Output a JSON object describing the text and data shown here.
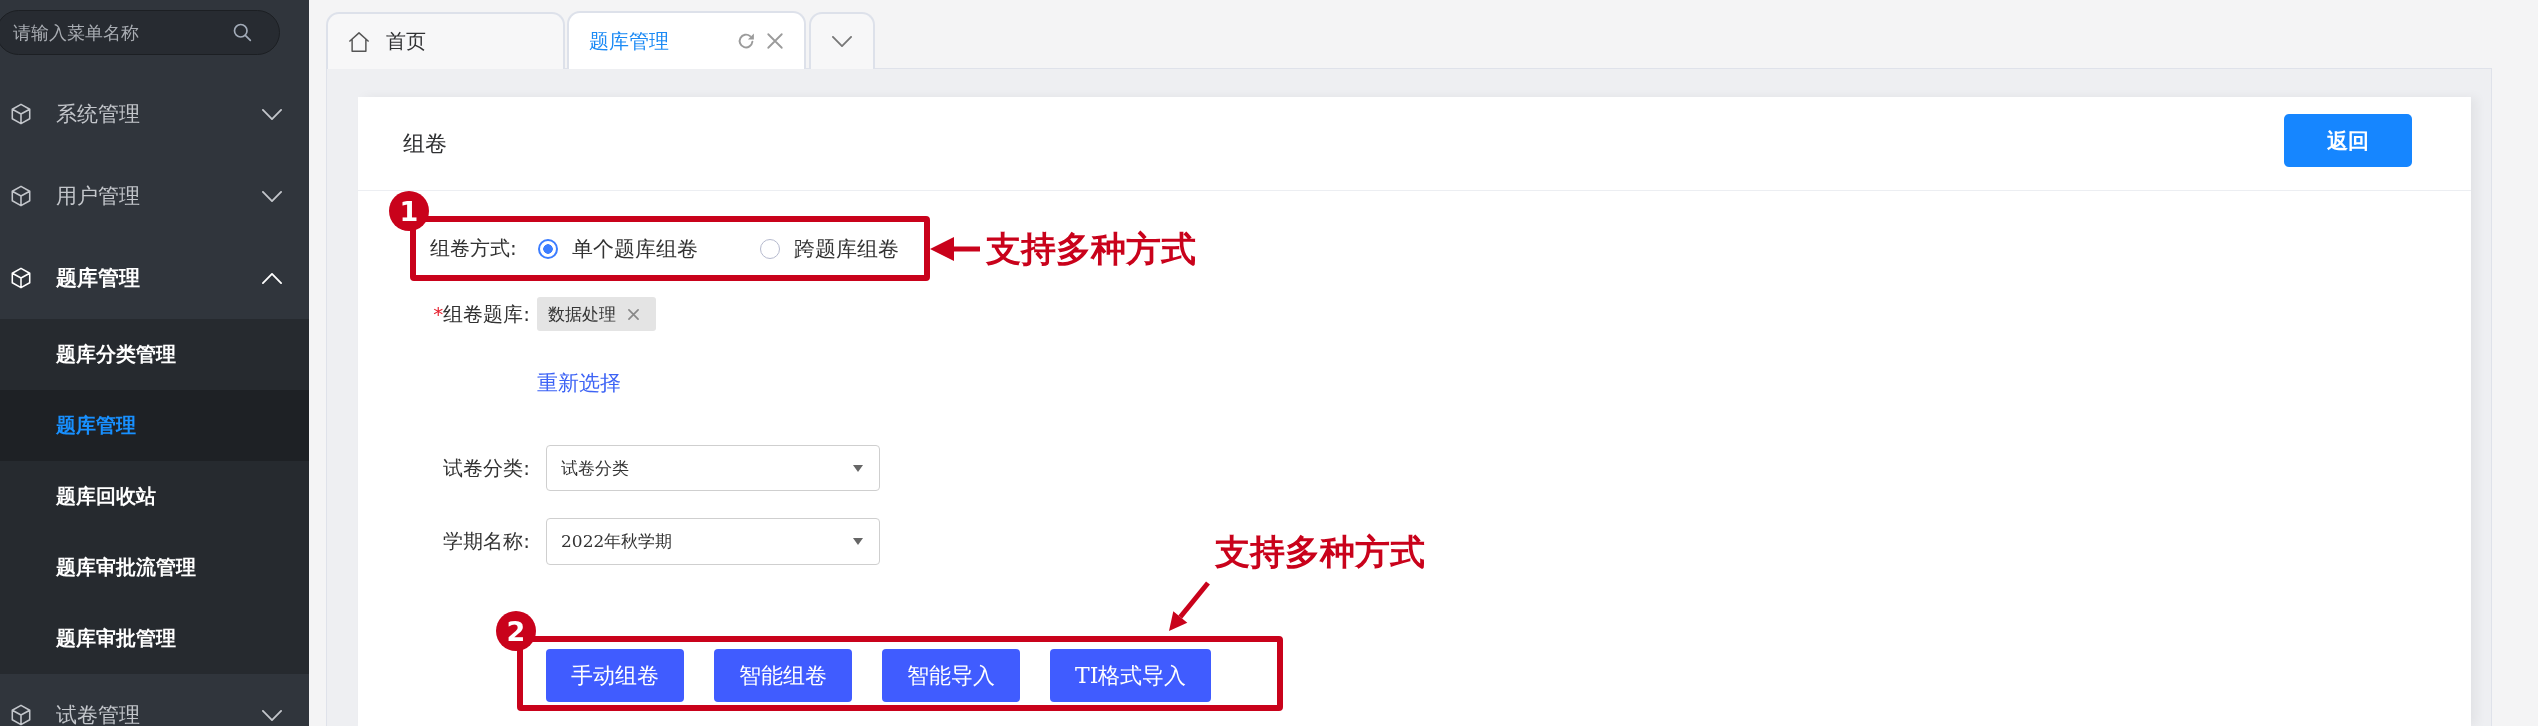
{
  "sidebar": {
    "search": {
      "placeholder": "请输入菜单名称"
    },
    "menu": [
      {
        "label": "系统管理",
        "expanded": false
      },
      {
        "label": "用户管理",
        "expanded": false
      },
      {
        "label": "题库管理",
        "expanded": true,
        "children": [
          {
            "label": "题库分类管理",
            "selected": false
          },
          {
            "label": "题库管理",
            "selected": true
          },
          {
            "label": "题库回收站",
            "selected": false
          },
          {
            "label": "题库审批流管理",
            "selected": false
          },
          {
            "label": "题库审批管理",
            "selected": false
          }
        ]
      },
      {
        "label": "试卷管理",
        "expanded": false
      }
    ]
  },
  "tabs": [
    {
      "kind": "home",
      "label": "首页",
      "selected": false
    },
    {
      "kind": "page",
      "label": "题库管理",
      "selected": true
    }
  ],
  "card": {
    "title": "组卷",
    "back_button": "返回"
  },
  "form": {
    "mode": {
      "label": "组卷方式:",
      "options": [
        {
          "label": "单个题库组卷",
          "selected": true
        },
        {
          "label": "跨题库组卷",
          "selected": false
        }
      ],
      "annotation": {
        "kind": "side",
        "number": "1",
        "text": "支持多种方式"
      }
    },
    "bank": {
      "required_mark": "*",
      "label": "组卷题库:",
      "tags": [
        {
          "label": "数据处理"
        }
      ],
      "reselect_link": "重新选择"
    },
    "category": {
      "label": "试卷分类:",
      "value": "试卷分类"
    },
    "term": {
      "label": "学期名称:",
      "value": "2022年秋学期"
    },
    "actions": {
      "buttons": [
        "手动组卷",
        "智能组卷",
        "智能导入",
        "TI格式导入"
      ],
      "annotation": {
        "kind": "above",
        "number": "2",
        "text": "支持多种方式"
      }
    }
  }
}
